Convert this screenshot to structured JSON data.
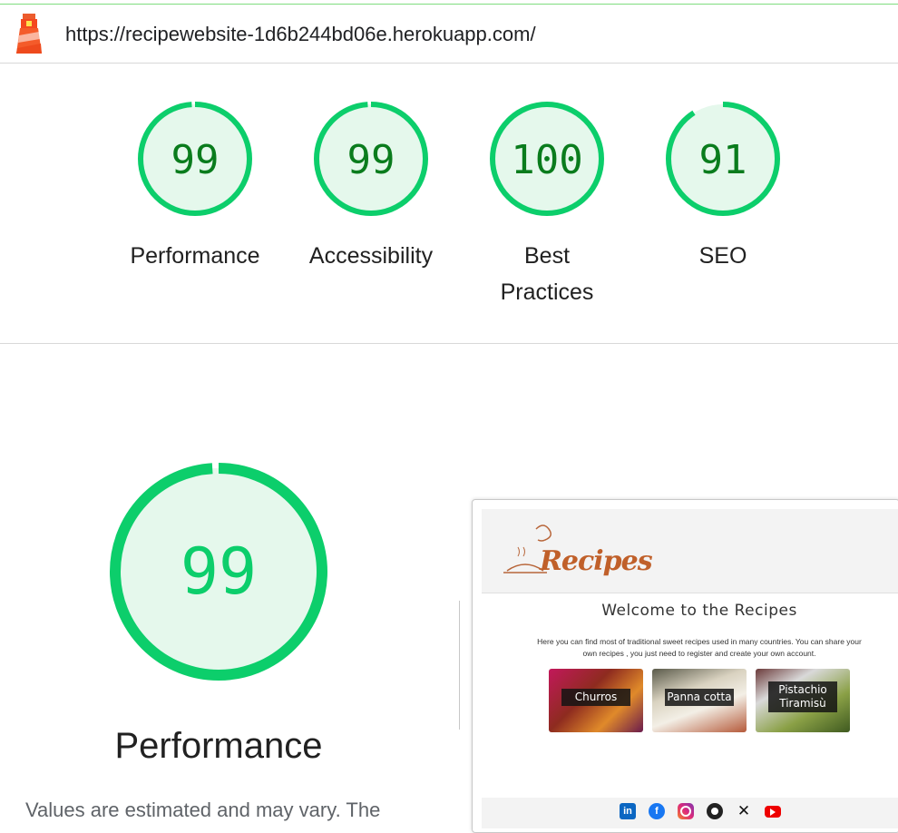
{
  "url": "https://recipewebsite-1d6b244bd06e.herokuapp.com/",
  "colors": {
    "pass": "#0cce6b",
    "pass_text": "#0a7c1d",
    "pass_fill": "#e5f8ec"
  },
  "categories": [
    {
      "score": "99",
      "label": "Performance",
      "fraction": 0.99
    },
    {
      "score": "99",
      "label": "Accessibility",
      "fraction": 0.99
    },
    {
      "score": "100",
      "label": "Best Practices",
      "label_line1": "Best",
      "label_line2": "Practices",
      "fraction": 1.0
    },
    {
      "score": "91",
      "label": "SEO",
      "fraction": 0.91
    }
  ],
  "main": {
    "score": "99",
    "fraction": 0.99,
    "title": "Performance",
    "note": "Values are estimated and may vary. The"
  },
  "screenshot": {
    "logo_text": "Recipes",
    "heading": "Welcome to the Recipes",
    "intro": "Here you can find most of traditional sweet recipes used in many countries. You can share your own recipes , you just need to register and create your own account.",
    "cards": [
      {
        "label": "Churros"
      },
      {
        "label": "Panna cotta"
      },
      {
        "label_line1": "Pistachio",
        "label_line2": "Tiramisù"
      }
    ],
    "social_icons": [
      "linkedin-icon",
      "facebook-icon",
      "instagram-icon",
      "github-icon",
      "x-icon",
      "youtube-icon"
    ]
  }
}
